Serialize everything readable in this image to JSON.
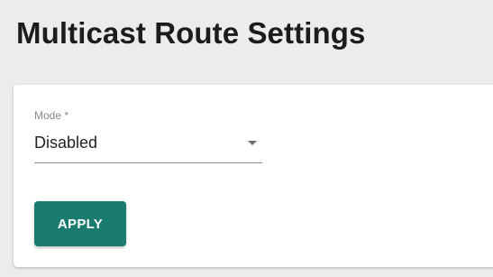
{
  "header": {
    "title": "Multicast Route Settings"
  },
  "form": {
    "mode": {
      "label": "Mode *",
      "value": "Disabled",
      "icon": "dropdown-arrow-icon"
    },
    "apply_label": "APPLY"
  },
  "colors": {
    "accent": "#1a7c6f",
    "background": "#ececec",
    "card": "#ffffff"
  }
}
